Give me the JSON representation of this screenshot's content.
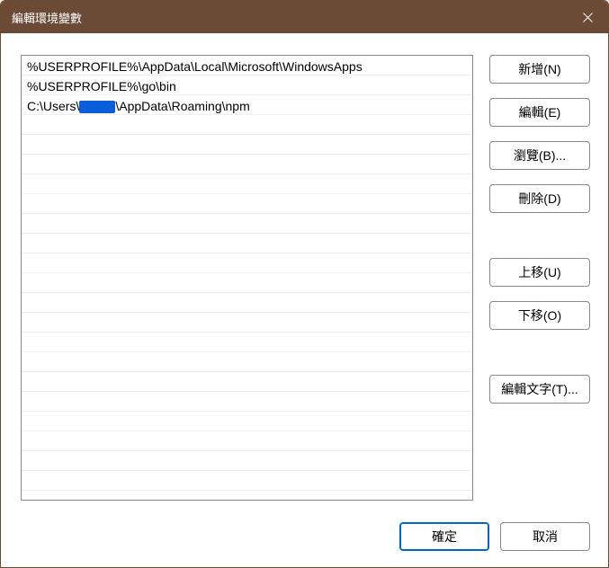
{
  "titlebar": {
    "title": "編輯環境變數"
  },
  "list": {
    "items": [
      "%USERPROFILE%\\AppData\\Local\\Microsoft\\WindowsApps",
      "%USERPROFILE%\\go\\bin",
      "C:\\Users\\____\\AppData\\Roaming\\npm"
    ],
    "redacted_index": 2,
    "redacted_prefix": "C:\\Users\\",
    "redacted_suffix": "\\AppData\\Roaming\\npm"
  },
  "buttons": {
    "new": "新增(N)",
    "edit": "編輯(E)",
    "browse": "瀏覽(B)...",
    "delete": "刪除(D)",
    "moveUp": "上移(U)",
    "moveDown": "下移(O)",
    "editText": "編輯文字(T)..."
  },
  "footer": {
    "ok": "確定",
    "cancel": "取消"
  }
}
